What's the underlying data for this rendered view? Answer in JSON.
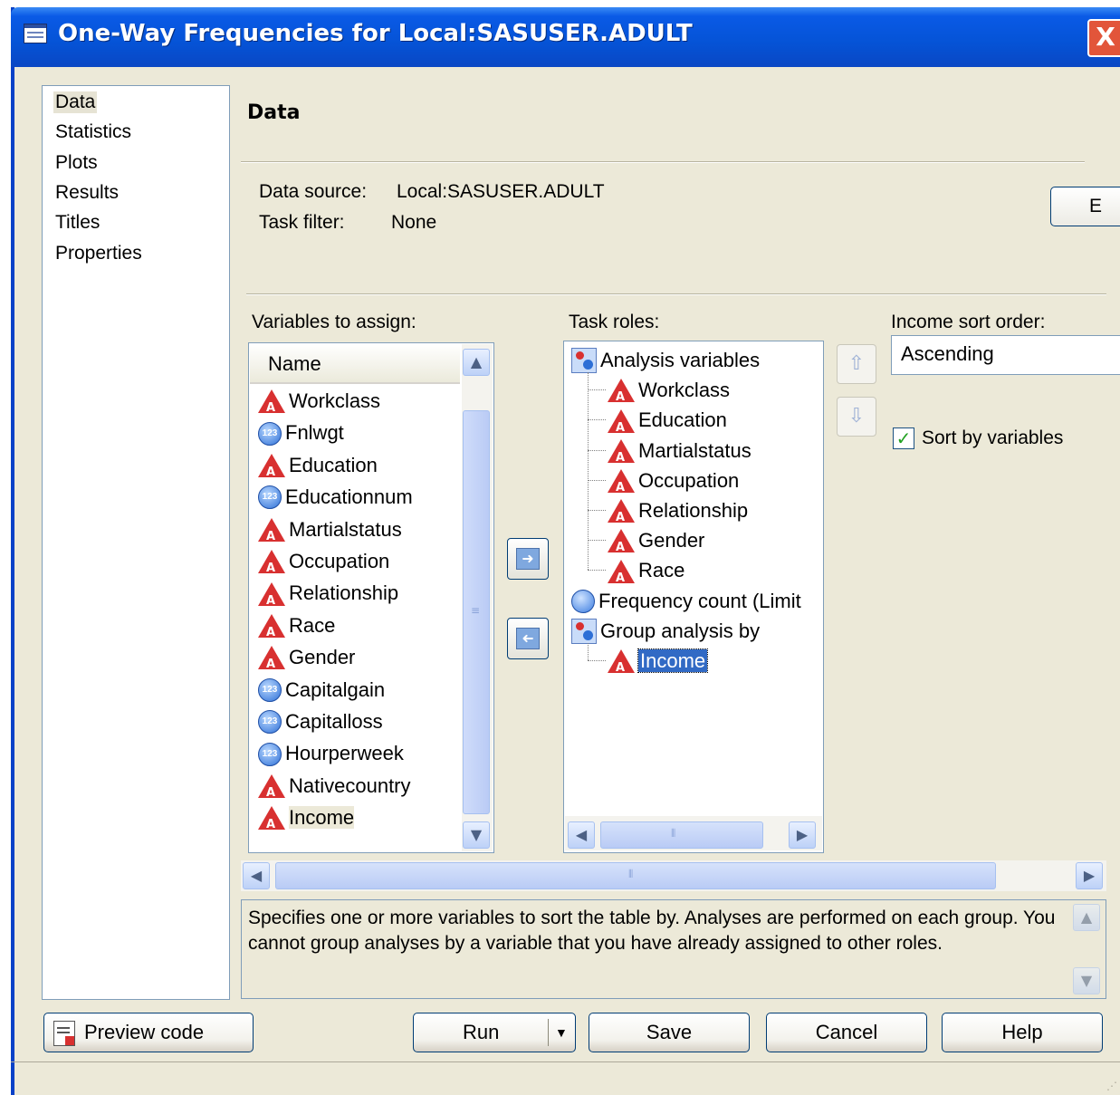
{
  "window": {
    "title": "One-Way Frequencies for Local:SASUSER.ADULT",
    "close_label": "X"
  },
  "nav": {
    "items": [
      "Data",
      "Statistics",
      "Plots",
      "Results",
      "Titles",
      "Properties"
    ],
    "selected": "Data"
  },
  "section": {
    "title": "Data"
  },
  "info": {
    "data_source_label": "Data source:",
    "data_source_value": "Local:SASUSER.ADULT",
    "task_filter_label": "Task filter:",
    "task_filter_value": "None",
    "edit_button_label": "E"
  },
  "variables": {
    "label": "Variables to assign:",
    "column_header": "Name",
    "items": [
      {
        "name": "Workclass",
        "type": "character"
      },
      {
        "name": "Fnlwgt",
        "type": "numeric"
      },
      {
        "name": "Education",
        "type": "character"
      },
      {
        "name": "Educationnum",
        "type": "numeric"
      },
      {
        "name": "Martialstatus",
        "type": "character"
      },
      {
        "name": "Occupation",
        "type": "character"
      },
      {
        "name": "Relationship",
        "type": "character"
      },
      {
        "name": "Race",
        "type": "character"
      },
      {
        "name": "Gender",
        "type": "character"
      },
      {
        "name": "Capitalgain",
        "type": "numeric"
      },
      {
        "name": "Capitalloss",
        "type": "numeric"
      },
      {
        "name": "Hourperweek",
        "type": "numeric"
      },
      {
        "name": "Nativecountry",
        "type": "character"
      },
      {
        "name": "Income",
        "type": "character"
      }
    ]
  },
  "task_roles": {
    "label": "Task roles:",
    "analysis_label": "Analysis variables",
    "analysis_items": [
      "Workclass",
      "Education",
      "Martialstatus",
      "Occupation",
      "Relationship",
      "Gender",
      "Race"
    ],
    "frequency_label": "Frequency count  (Limit",
    "group_label": "Group analysis by",
    "group_items": [
      "Income"
    ]
  },
  "sort": {
    "label": "Income sort order:",
    "value": "Ascending",
    "checkbox_label": "Sort by variables",
    "checked": true
  },
  "help": {
    "text": "Specifies one or more variables to sort the table by. Analyses are performed on each group. You cannot group analyses by a variable that you have already assigned to other roles."
  },
  "buttons": {
    "preview": "Preview code",
    "run": "Run",
    "save": "Save",
    "cancel": "Cancel",
    "help": "Help"
  },
  "colors": {
    "titlebar": "#0553d6",
    "face": "#ece9d8",
    "character_icon": "#d83030",
    "numeric_icon": "#2d6fd6",
    "selection": "#316ac5"
  }
}
